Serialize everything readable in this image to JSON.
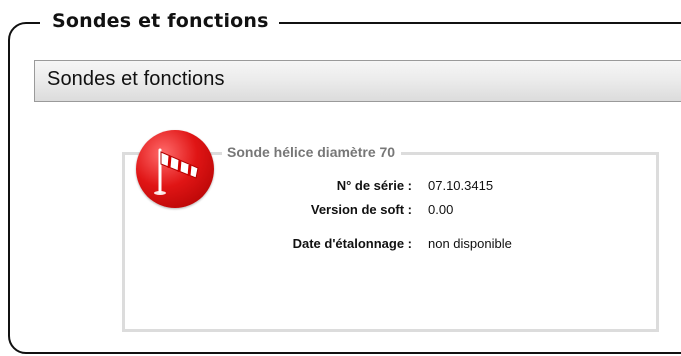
{
  "section": {
    "outer_title": "Sondes et fonctions",
    "header_title": "Sondes et fonctions"
  },
  "probe": {
    "name": "Sonde hélice diamètre 70",
    "icon": "propeller-probe-icon",
    "icon_color": "#e01515",
    "rows": [
      {
        "label": "N° de série :",
        "value": "07.10.3415"
      },
      {
        "label": "Version de soft :",
        "value": "0.00"
      },
      {
        "label": "Date d'étalonnage :",
        "value": "non disponible"
      }
    ]
  }
}
